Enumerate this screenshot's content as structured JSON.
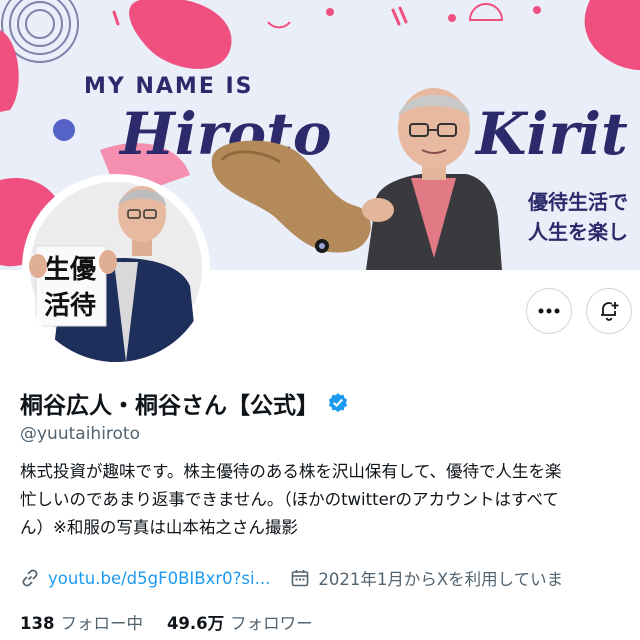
{
  "banner": {
    "my_name_is": "MY NAME IS",
    "first_name": "Hiroto",
    "last_name": "Kirit",
    "tagline_1": "優待生活で",
    "tagline_2": "人生を楽し",
    "accent_pink": "#f0507f",
    "accent_navy": "#2c2a6b",
    "background": "#e9eef8"
  },
  "avatar": {
    "calligraphy": [
      "生優",
      "活待"
    ]
  },
  "actions": {
    "more_icon": "more-horizontal-icon",
    "notify_icon": "bell-plus-icon"
  },
  "profile": {
    "display_name": "桐谷広人・桐谷さん【公式】",
    "verified_icon": "verified-badge-icon",
    "verified_color": "#1d9bf0",
    "handle": "@yuutaihiroto",
    "bio_lines": [
      "株式投資が趣味です。株主優待のある株を沢山保有して、優待で人生を楽",
      "忙しいのであまり返事できません。（ほかのtwitterのアカウントはすべて",
      "ん）※和服の写真は山本祐之さん撮影"
    ],
    "link_text": "youtu.be/d5gF0BIBxr0?si...",
    "joined_text": "2021年1月からXを利用していま",
    "following_count": "138",
    "following_label": "フォロー中",
    "followers_count": "49.6万",
    "followers_label": "フォロワー"
  }
}
